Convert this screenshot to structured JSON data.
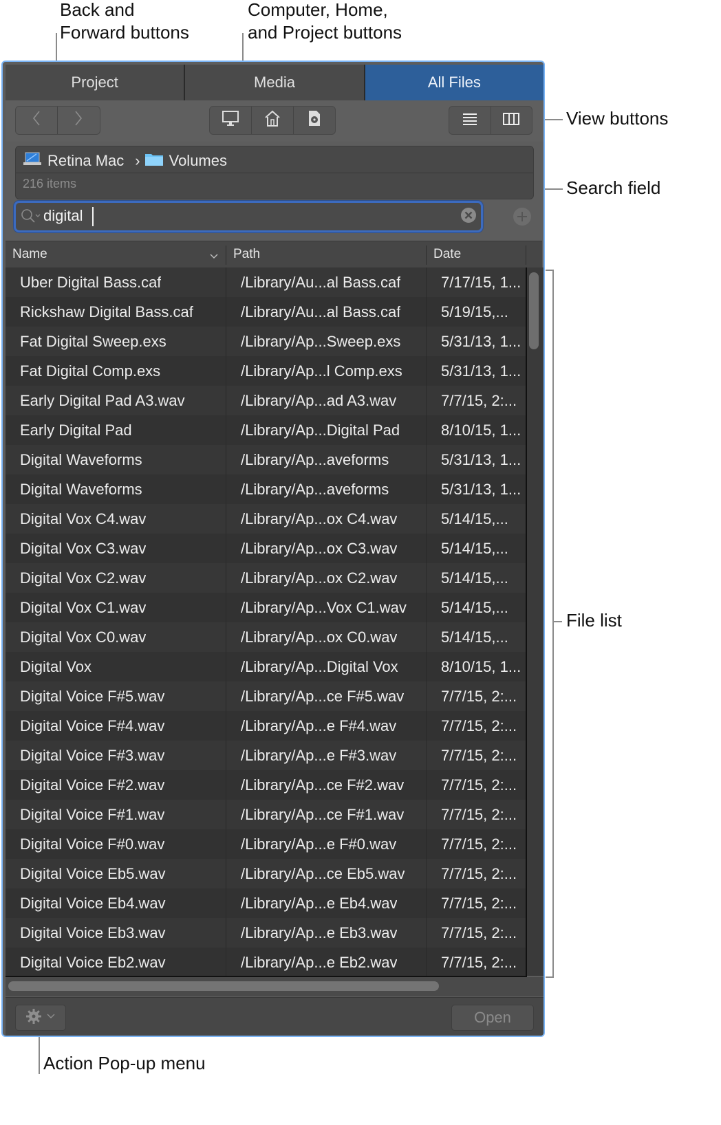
{
  "callouts": {
    "back_forward": [
      "Back and",
      "Forward buttons"
    ],
    "computer_home_project": [
      "Computer, Home,",
      "and Project buttons"
    ],
    "view_buttons": "View buttons",
    "search_field": "Search field",
    "file_list": "File list",
    "action_popup": "Action Pop-up menu"
  },
  "tabs": [
    {
      "label": "Project",
      "active": false
    },
    {
      "label": "Media",
      "active": false
    },
    {
      "label": "All Files",
      "active": true
    }
  ],
  "toolbar": {
    "nav": [
      {
        "icon": "chevron-left-icon",
        "glyph": "‹"
      },
      {
        "icon": "chevron-right-icon",
        "glyph": "›"
      }
    ],
    "locations": [
      {
        "icon": "computer-icon"
      },
      {
        "icon": "home-icon"
      },
      {
        "icon": "project-icon"
      }
    ],
    "views": [
      {
        "icon": "list-view-icon",
        "glyph": "☰"
      },
      {
        "icon": "column-view-icon"
      }
    ]
  },
  "path": {
    "segments": [
      {
        "icon": "laptop-icon",
        "label": "Retina Mac"
      },
      {
        "icon": "folder-icon",
        "label": "Volumes"
      }
    ],
    "separator": "›",
    "item_count": "216 items"
  },
  "search": {
    "value": "digital",
    "placeholder": ""
  },
  "columns": {
    "name": "Name",
    "path": "Path",
    "date": "Date"
  },
  "files": [
    {
      "name": "Uber Digital Bass.caf",
      "path": "/Library/Au...al Bass.caf",
      "date": "7/17/15, 1..."
    },
    {
      "name": "Rickshaw Digital Bass.caf",
      "path": "/Library/Au...al Bass.caf",
      "date": "5/19/15,..."
    },
    {
      "name": "Fat Digital Sweep.exs",
      "path": "/Library/Ap...Sweep.exs",
      "date": "5/31/13, 1..."
    },
    {
      "name": "Fat Digital Comp.exs",
      "path": "/Library/Ap...l Comp.exs",
      "date": "5/31/13, 1..."
    },
    {
      "name": "Early Digital Pad A3.wav",
      "path": "/Library/Ap...ad A3.wav",
      "date": "7/7/15, 2:..."
    },
    {
      "name": "Early Digital Pad",
      "path": "/Library/Ap...Digital Pad",
      "date": "8/10/15, 1..."
    },
    {
      "name": "Digital Waveforms",
      "path": "/Library/Ap...aveforms",
      "date": "5/31/13, 1..."
    },
    {
      "name": "Digital Waveforms",
      "path": "/Library/Ap...aveforms",
      "date": "5/31/13, 1..."
    },
    {
      "name": "Digital Vox C4.wav",
      "path": "/Library/Ap...ox C4.wav",
      "date": "5/14/15,..."
    },
    {
      "name": "Digital Vox C3.wav",
      "path": "/Library/Ap...ox C3.wav",
      "date": "5/14/15,..."
    },
    {
      "name": "Digital Vox C2.wav",
      "path": "/Library/Ap...ox C2.wav",
      "date": "5/14/15,..."
    },
    {
      "name": "Digital Vox C1.wav",
      "path": "/Library/Ap...Vox C1.wav",
      "date": "5/14/15,..."
    },
    {
      "name": "Digital Vox C0.wav",
      "path": "/Library/Ap...ox C0.wav",
      "date": "5/14/15,..."
    },
    {
      "name": "Digital Vox",
      "path": "/Library/Ap...Digital Vox",
      "date": "8/10/15, 1..."
    },
    {
      "name": "Digital Voice F#5.wav",
      "path": "/Library/Ap...ce F#5.wav",
      "date": "7/7/15, 2:..."
    },
    {
      "name": "Digital Voice F#4.wav",
      "path": "/Library/Ap...e F#4.wav",
      "date": "7/7/15, 2:..."
    },
    {
      "name": "Digital Voice F#3.wav",
      "path": "/Library/Ap...e F#3.wav",
      "date": "7/7/15, 2:..."
    },
    {
      "name": "Digital Voice F#2.wav",
      "path": "/Library/Ap...ce F#2.wav",
      "date": "7/7/15, 2:..."
    },
    {
      "name": "Digital Voice F#1.wav",
      "path": "/Library/Ap...ce F#1.wav",
      "date": "7/7/15, 2:..."
    },
    {
      "name": "Digital Voice F#0.wav",
      "path": "/Library/Ap...e F#0.wav",
      "date": "7/7/15, 2:..."
    },
    {
      "name": "Digital Voice Eb5.wav",
      "path": "/Library/Ap...ce Eb5.wav",
      "date": "7/7/15, 2:..."
    },
    {
      "name": "Digital Voice Eb4.wav",
      "path": "/Library/Ap...e Eb4.wav",
      "date": "7/7/15, 2:..."
    },
    {
      "name": "Digital Voice Eb3.wav",
      "path": "/Library/Ap...e Eb3.wav",
      "date": "7/7/15, 2:..."
    },
    {
      "name": "Digital Voice Eb2.wav",
      "path": "/Library/Ap...e Eb2.wav",
      "date": "7/7/15, 2:..."
    }
  ],
  "footer": {
    "action_icon": "gear-icon",
    "open_label": "Open"
  },
  "colors": {
    "accent": "#2d5f9a",
    "window_border": "#7ab4f5",
    "search_focus": "#3c6bbf"
  }
}
